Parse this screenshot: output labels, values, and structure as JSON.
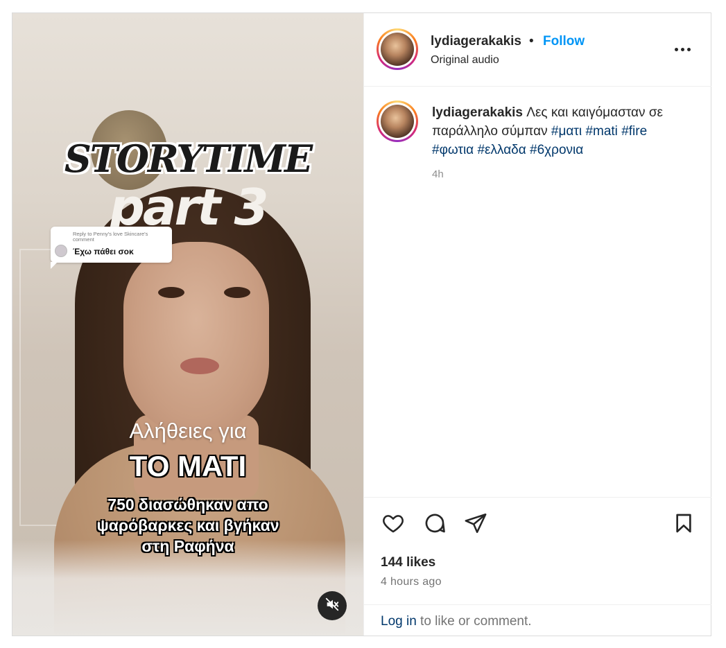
{
  "post": {
    "username": "lydiagerakakis",
    "separator": "•",
    "follow_label": "Follow",
    "audio_label": "Original audio",
    "more_icon": "more-horizontal-icon"
  },
  "media": {
    "overlay_title": "STORYTIME",
    "overlay_part": "part 3",
    "reply_context": "Reply to Penny's love Skincare's comment",
    "reply_text": "Έχω πάθει σοκ",
    "line1": "Αλήθειες για",
    "line2": "ΤΟ ΜΑΤΙ",
    "line3a": "750 διασώθηκαν απο",
    "line3b": "ψαρόβαρκες και βγήκαν",
    "line3c": "στη Ραφήνα",
    "mute_icon": "muted-speaker-icon"
  },
  "caption": {
    "username": "lydiagerakakis",
    "text": "Λες και καιγόμασταν σε παράλληλο σύμπαν",
    "tags": [
      "#ματι",
      "#mati",
      "#fire",
      "#φωτια",
      "#ελλαδα",
      "#6χρονια"
    ],
    "time": "4h"
  },
  "actions": {
    "icons": [
      "heart-icon",
      "comment-icon",
      "share-icon",
      "bookmark-icon"
    ],
    "likes": "144 likes",
    "time_ago": "4 hours ago"
  },
  "login": {
    "link": "Log in",
    "rest": " to like or comment."
  },
  "colors": {
    "follow_blue": "#0095f6",
    "hashtag": "#00376b",
    "muted_text": "#737373"
  }
}
